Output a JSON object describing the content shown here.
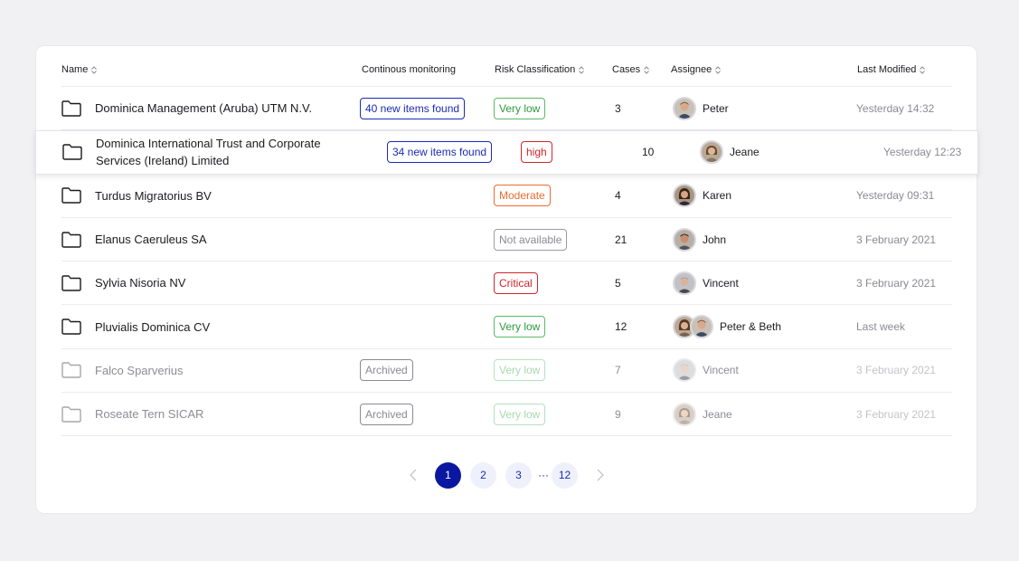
{
  "columns": {
    "name": "Name",
    "monitoring": "Continous monitoring",
    "risk": "Risk Classification",
    "cases": "Cases",
    "assignee": "Assignee",
    "modified": "Last Modified"
  },
  "rows": [
    {
      "name": "Dominica Management (Aruba) UTM N.V.",
      "monitoring": "40 new items found",
      "risk": "Very low",
      "cases": "3",
      "assignee": "Peter",
      "modified": "Yesterday 14:32"
    },
    {
      "name": "Dominica International Trust and Corporate Services (Ireland) Limited",
      "monitoring": "34 new items found",
      "risk": "high",
      "cases": "10",
      "assignee": "Jeane",
      "modified": "Yesterday 12:23"
    },
    {
      "name": "Turdus Migratorius BV",
      "monitoring": "",
      "risk": "Moderate",
      "cases": "4",
      "assignee": "Karen",
      "modified": "Yesterday 09:31"
    },
    {
      "name": "Elanus Caeruleus SA",
      "monitoring": "",
      "risk": "Not available",
      "cases": "21",
      "assignee": "John",
      "modified": "3 February 2021"
    },
    {
      "name": "Sylvia Nisoria NV",
      "monitoring": "",
      "risk": "Critical",
      "cases": "5",
      "assignee": "Vincent",
      "modified": "3 February 2021"
    },
    {
      "name": "Pluvialis Dominica CV",
      "monitoring": "",
      "risk": "Very low",
      "cases": "12",
      "assignee": "Peter & Beth",
      "modified": "Last week"
    },
    {
      "name": "Falco Sparverius",
      "monitoring": "Archived",
      "risk": "Very low",
      "cases": "7",
      "assignee": "Vincent",
      "modified": "3 February 2021"
    },
    {
      "name": "Roseate Tern SICAR",
      "monitoring": "Archived",
      "risk": "Very low",
      "cases": "9",
      "assignee": "Jeane",
      "modified": "3 February 2021"
    }
  ],
  "pagination": {
    "pages": [
      "1",
      "2",
      "3",
      "12"
    ],
    "ellipsis": "···",
    "current": "1"
  },
  "colors": {
    "accent": "#0a17a0",
    "risk_very_low": "#2e9b3c",
    "risk_high": "#d0242b",
    "risk_moderate": "#ee6a2f",
    "risk_not_available": "#8a8a93"
  },
  "icons": {
    "row": "folder-icon",
    "sort": "sort-icon",
    "prev": "chevron-left-icon",
    "next": "chevron-right-icon"
  }
}
